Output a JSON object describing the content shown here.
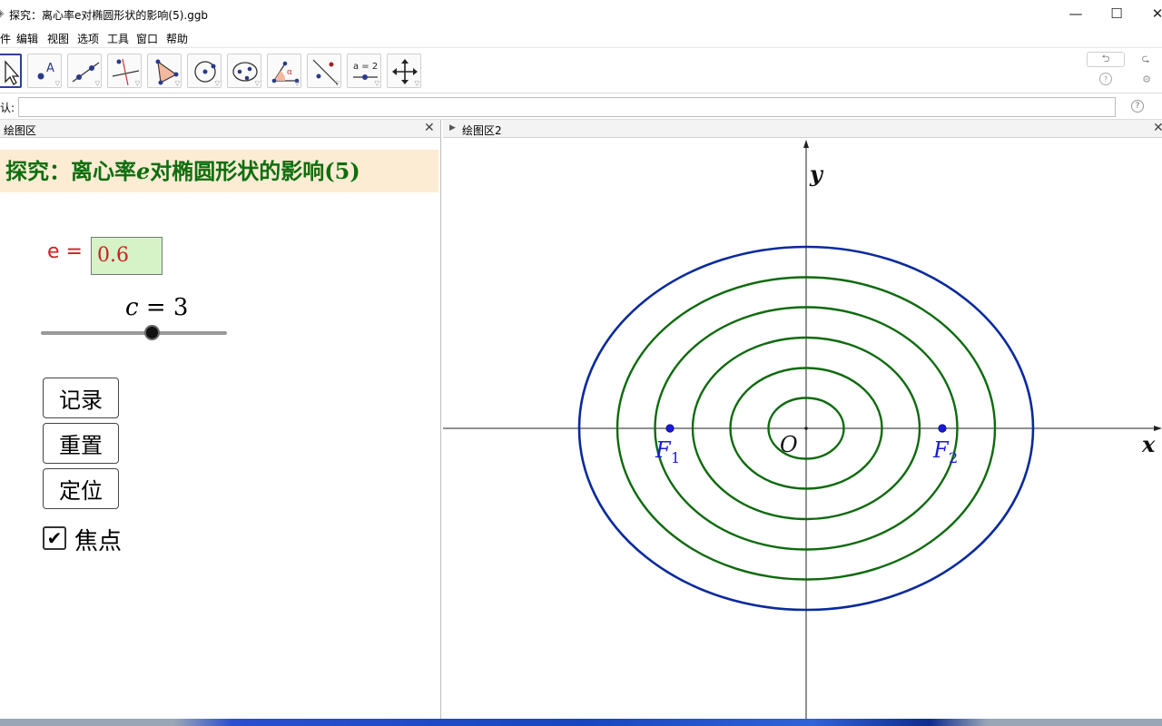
{
  "window": {
    "title": "探究：离心率e对椭圆形状的影响(5).ggb",
    "minimize": "—",
    "maximize": "☐",
    "close": "✕"
  },
  "menu": [
    "件",
    "编辑",
    "视图",
    "选项",
    "工具",
    "窗口",
    "帮助"
  ],
  "toolbar": {
    "tools": [
      "move",
      "point",
      "line",
      "perpendicular",
      "polygon",
      "circle",
      "conic",
      "angle",
      "reflect",
      "slider",
      "move-graphics"
    ],
    "slider_tool_label": "a = 2",
    "angle_tool_label": "α",
    "point_tool_label": "A",
    "undo": "⮌",
    "redo": "⮎",
    "help_icon": "?",
    "settings_icon": "⚙"
  },
  "input_bar": {
    "label": "认:",
    "value": "",
    "help": "?"
  },
  "graphics1": {
    "title": "绘图区",
    "close": "✕",
    "banner_prefix": "探究：离心率",
    "banner_var": "e",
    "banner_suffix": "对椭圆形状的影响(5)",
    "e_label": "e =",
    "e_value": "0.6",
    "c_label_var": "c",
    "c_label_rest": " = 3",
    "c_value": 3,
    "c_slider_fraction": 0.6,
    "buttons": [
      "记录",
      "重置",
      "定位"
    ],
    "checkbox_label": "焦点",
    "checkbox_checked": true,
    "check_mark": "✔"
  },
  "graphics2": {
    "title": "绘图区2",
    "close": "✕",
    "arrow": "▶",
    "x_axis_label": "x",
    "y_axis_label": "y",
    "origin_label": "O",
    "focus1_label": "F",
    "focus1_sub": "1",
    "focus2_label": "F",
    "focus2_sub": "2",
    "colors": {
      "outer_ellipse": "#0a2a9c",
      "inner_ellipses": "#0e6a0e",
      "foci": "#1a1adb"
    },
    "chart_data": {
      "type": "scatter",
      "c": 3,
      "e": 0.6,
      "foci": [
        [
          -3,
          0
        ],
        [
          3,
          0
        ]
      ],
      "outer_ellipse": {
        "a": 5,
        "b": 4
      },
      "recorded_ellipses": [
        {
          "a": 4.16,
          "b": 3.33
        },
        {
          "a": 3.33,
          "b": 2.67
        },
        {
          "a": 2.5,
          "b": 2.0
        },
        {
          "a": 1.67,
          "b": 1.33
        },
        {
          "a": 0.83,
          "b": 0.67
        }
      ],
      "xlabel": "x",
      "ylabel": "y"
    }
  }
}
